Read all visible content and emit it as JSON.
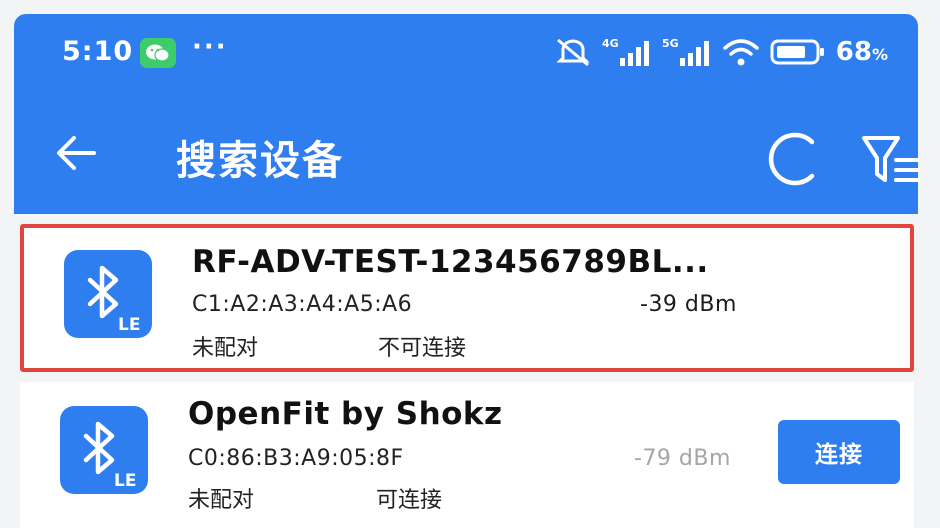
{
  "status_bar": {
    "time": "5:10",
    "more_dots": "···",
    "battery_percent": "68",
    "battery_unit": "%",
    "network_4g": "4G",
    "network_5g": "5G"
  },
  "app_bar": {
    "title": "搜索设备",
    "background_color": "#2f7ef0"
  },
  "devices": [
    {
      "name": "RF-ADV-TEST-123456789BL...",
      "mac": "C1:A2:A3:A4:A5:A6",
      "rssi": "-39 dBm",
      "bond_state": "未配对",
      "connectable": "不可连接",
      "badge": "LE",
      "highlighted": true
    },
    {
      "name": "OpenFit by Shokz",
      "mac": "C0:86:B3:A9:05:8F",
      "rssi": "-79 dBm",
      "bond_state": "未配对",
      "connectable": "可连接",
      "badge": "LE",
      "connect_label": "连接"
    }
  ],
  "colors": {
    "accent": "#2f7ef0",
    "highlight_border": "#e0463e",
    "weak_rssi": "#a6a6a6"
  }
}
